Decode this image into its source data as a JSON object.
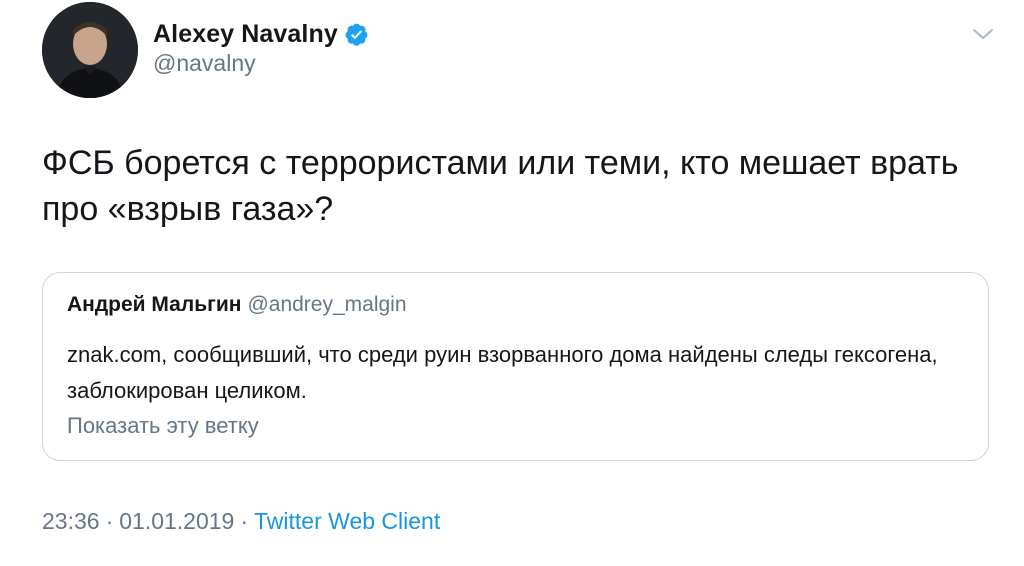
{
  "author": {
    "display_name": "Alexey Navalny",
    "handle": "@navalny",
    "verified": true,
    "avatar_icon": "profile-photo"
  },
  "tweet": {
    "text": "ФСБ борется с террористами или теми, кто мешает врать про «взрыв газа»?"
  },
  "quoted_tweet": {
    "author_name": "Андрей Мальгин",
    "author_handle": "@andrey_malgin",
    "text": "znak.com, сообщивший, что среди руин взорванного дома найдены следы гексогена, заблокирован целиком.",
    "show_thread_label": "Показать эту ветку"
  },
  "meta": {
    "time": "23:36",
    "separator": "·",
    "date": "01.01.2019",
    "client": "Twitter Web Client"
  },
  "colors": {
    "text_primary": "#14171a",
    "text_secondary": "#657786",
    "accent": "#1b95e0",
    "border": "#ccd6dd",
    "verified_badge": "#1da1f2"
  },
  "icons": {
    "verified": "verified-badge-icon",
    "menu": "chevron-down-icon"
  }
}
